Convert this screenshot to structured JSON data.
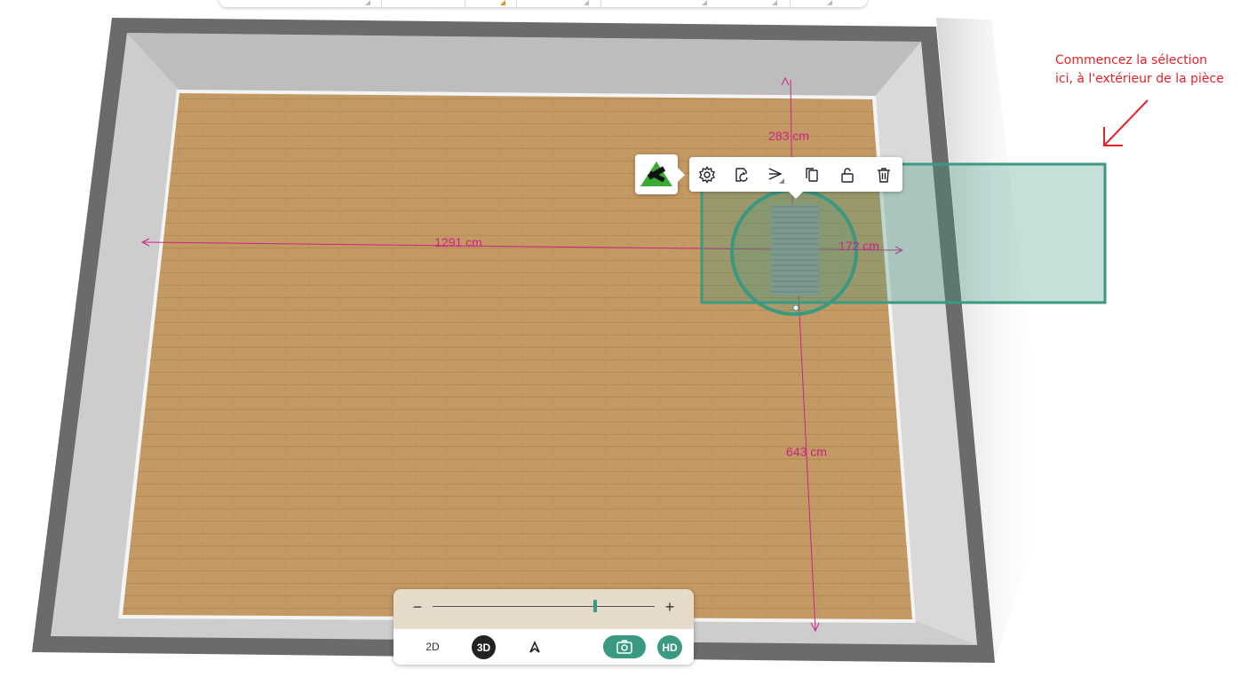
{
  "colors": {
    "accent": "#3a9981",
    "dimension": "#cc2288",
    "annotation": "#e8212a",
    "wall": "#6b6b6b",
    "floor": "#c49a64"
  },
  "dimensions": {
    "top": "283 cm",
    "left": "1291 cm",
    "right": "172 cm",
    "bottom": "643 cm"
  },
  "annotation": {
    "line1": "Commencez la sélection",
    "line2": "ici, à l'extérieur de la pièce"
  },
  "context_toolbar": {
    "brand_logo": "leroy-merlin-logo",
    "buttons": [
      "gear-icon",
      "replace-icon",
      "align-icon",
      "duplicate-icon",
      "unlock-icon",
      "trash-icon"
    ]
  },
  "view_panel": {
    "zoom_minus": "−",
    "zoom_plus": "+",
    "zoom_level": 0.73,
    "mode_2d": "2D",
    "mode_3d": "3D",
    "active_mode": "3D",
    "hd": "HD"
  }
}
